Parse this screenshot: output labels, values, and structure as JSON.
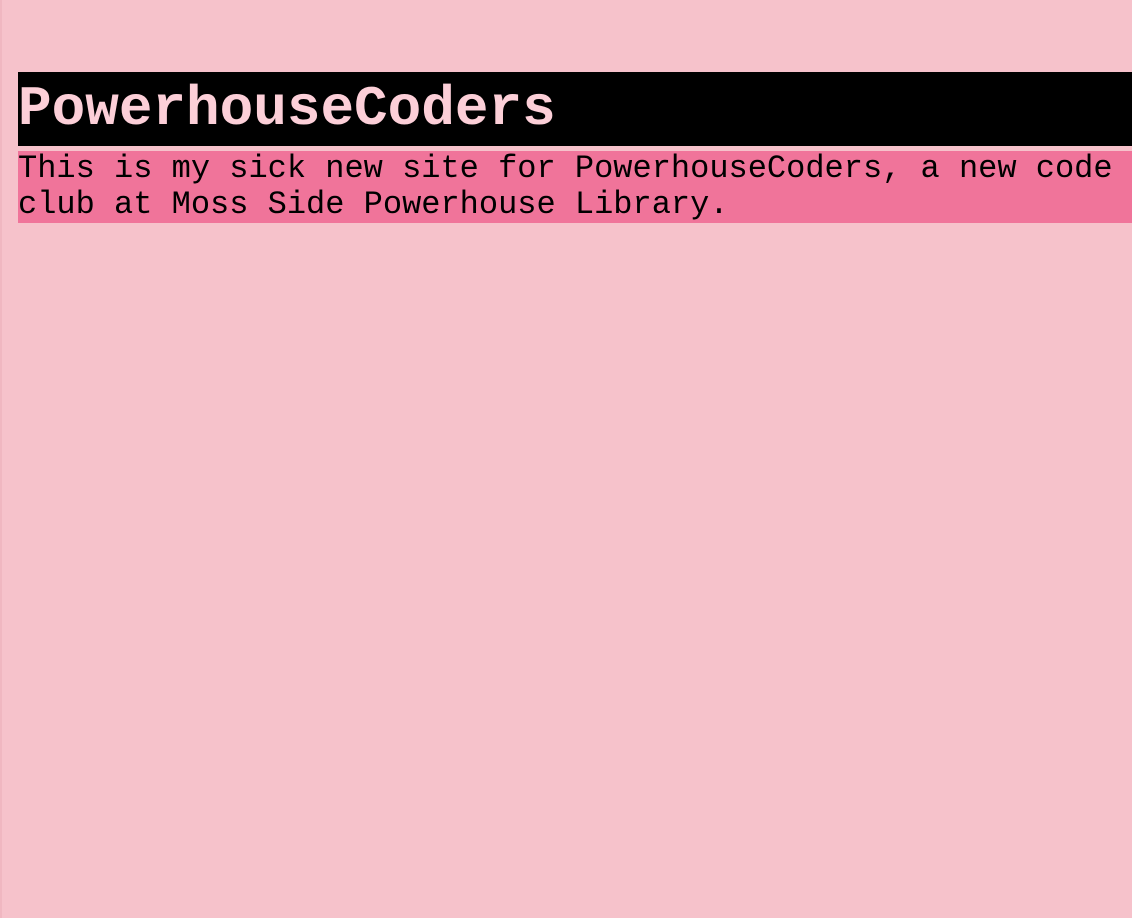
{
  "header": {
    "title": "PowerhouseCoders"
  },
  "main": {
    "intro": "This is my sick new site for PowerhouseCoders, a new code club at Moss Side Powerhouse Library."
  },
  "colors": {
    "page_background": "#f6c2cb",
    "heading_background": "#000000",
    "heading_text": "#fccfd8",
    "intro_background": "#f0749a",
    "intro_text": "#000000"
  }
}
